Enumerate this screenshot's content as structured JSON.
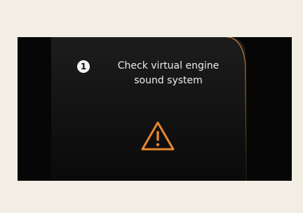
{
  "message": {
    "index": "1",
    "line1": "Check virtual engine",
    "line2": "sound system"
  },
  "icons": {
    "warning": "warning-triangle-icon"
  },
  "colors": {
    "page_background": "#f3eee4",
    "display_background": "#060606",
    "text": "#ececec",
    "warning": "#e8872e",
    "frame_accent": "#c9853a"
  }
}
